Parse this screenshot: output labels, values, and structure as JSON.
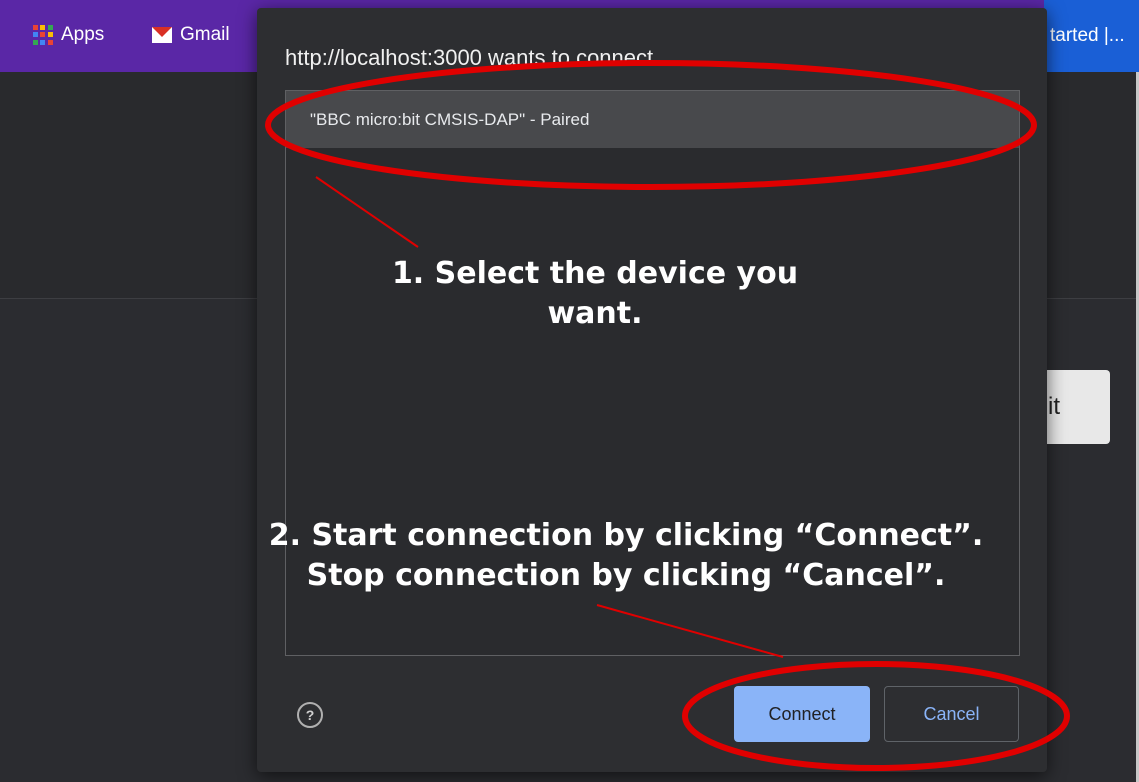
{
  "bookmarks": {
    "apps_label": "Apps",
    "gmail_label": "Gmail",
    "right_label": "tarted |..."
  },
  "background": {
    "button_label": "it"
  },
  "dialog": {
    "title": "http://localhost:3000 wants to connect",
    "devices": [
      {
        "label": "\"BBC micro:bit CMSIS-DAP\" - Paired"
      }
    ],
    "help_glyph": "?",
    "connect_label": "Connect",
    "cancel_label": "Cancel"
  },
  "annotations": {
    "step1_line1": "1. Select the device you",
    "step1_line2": "want.",
    "step2_line1": "2. Start connection by clicking “Connect”.",
    "step2_line2": "Stop connection by clicking “Cancel”.",
    "color": "#e00000"
  },
  "colors": {
    "bookmarks_bar": "#5a27a6",
    "accent_blue": "#8ab4f8",
    "dialog_bg": "#2d2e31"
  }
}
